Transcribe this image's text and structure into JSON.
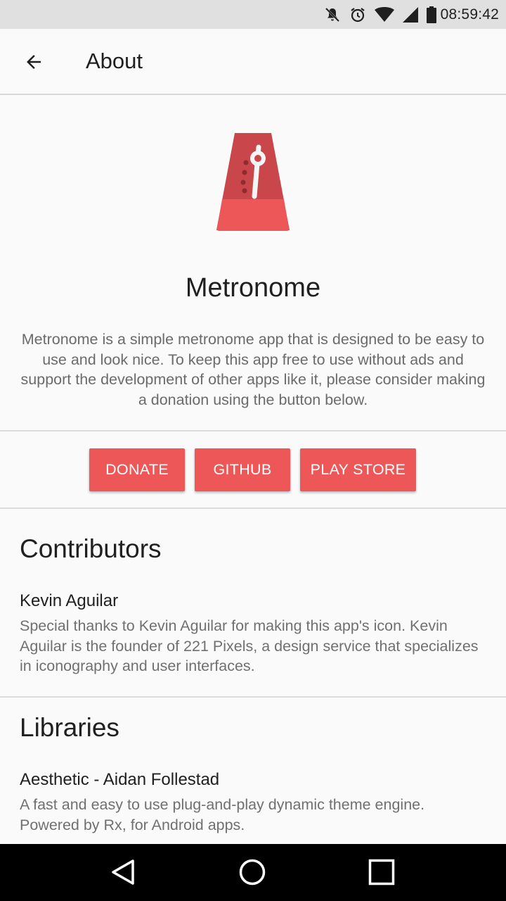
{
  "status_bar": {
    "time": "08:59:42",
    "icons": [
      "mute-icon",
      "alarm-icon",
      "wifi-icon",
      "signal-icon",
      "battery-icon"
    ]
  },
  "app_bar": {
    "back_icon": "arrow-back-icon",
    "title": "About"
  },
  "app": {
    "logo": "metronome-logo",
    "name": "Metronome",
    "description": "Metronome is a simple metronome app that is designed to be easy to use and look nice. To keep this app free to use without ads and support the development of other apps like it, please consider making a donation using the button below."
  },
  "buttons": {
    "donate": "DONATE",
    "github": "GITHUB",
    "play_store": "PLAY STORE"
  },
  "contributors": {
    "title": "Contributors",
    "items": [
      {
        "name": "Kevin Aguilar",
        "text": "Special thanks to Kevin Aguilar for making this app's icon. Kevin Aguilar is the founder of 221 Pixels, a design service that specializes in iconography and user interfaces."
      }
    ]
  },
  "libraries": {
    "title": "Libraries",
    "items": [
      {
        "name": "Aesthetic - Aidan Follestad",
        "text": "A fast and easy to use plug-and-play dynamic theme engine. Powered by Rx, for Android apps."
      }
    ]
  },
  "nav_bar": {
    "icons": [
      "back-triangle-icon",
      "home-circle-icon",
      "recents-square-icon"
    ]
  },
  "colors": {
    "accent": "#ee5757",
    "background": "#fafafa",
    "status_bar": "#e0e0e0"
  }
}
